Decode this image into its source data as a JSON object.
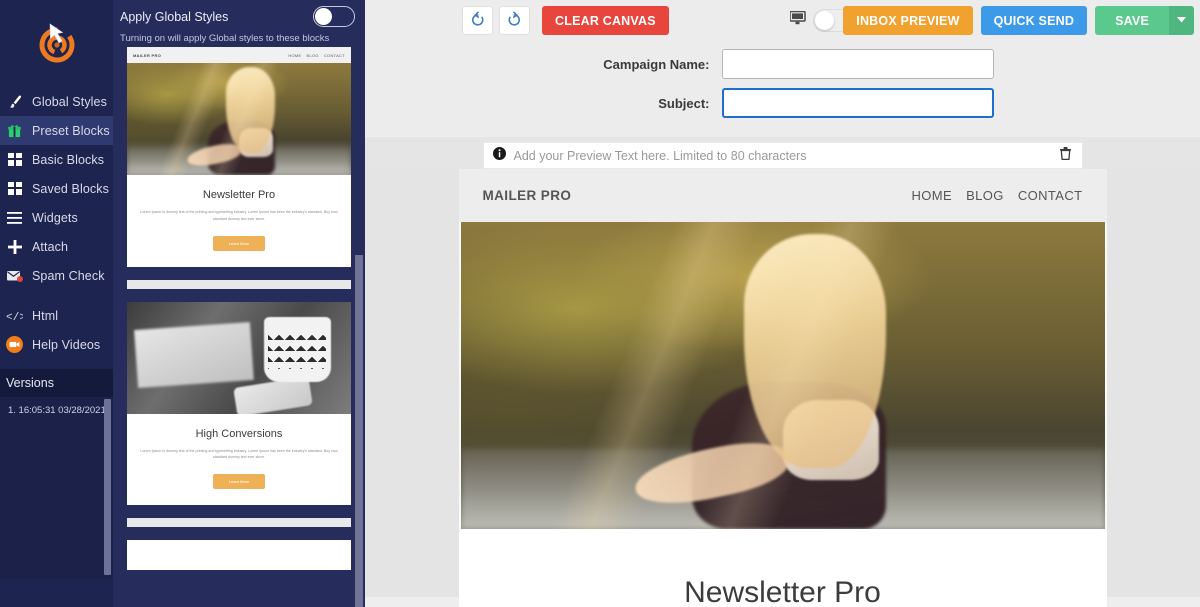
{
  "app": {
    "logo_icon": "target-cursor-logo"
  },
  "sidebar": {
    "items": [
      {
        "label": "Global Styles",
        "icon": "paintbrush-icon",
        "active": false
      },
      {
        "label": "Preset Blocks",
        "icon": "gift-icon",
        "active": true
      },
      {
        "label": "Basic Blocks",
        "icon": "grid-blocks-icon",
        "active": false
      },
      {
        "label": "Saved Blocks",
        "icon": "grid-blocks-icon",
        "active": false
      },
      {
        "label": "Widgets",
        "icon": "hamburger-icon",
        "active": false
      },
      {
        "label": "Attach",
        "icon": "plus-icon",
        "active": false
      },
      {
        "label": "Spam Check",
        "icon": "envelope-alert-icon",
        "active": false
      },
      {
        "label": "Html",
        "icon": "code-brackets-icon",
        "active": false
      },
      {
        "label": "Help Videos",
        "icon": "video-camera-icon",
        "active": false
      }
    ],
    "versions_header": "Versions",
    "versions": [
      "1. 16:05:31 03/28/2021"
    ]
  },
  "preset_panel": {
    "apply_global_styles_label": "Apply Global Styles",
    "apply_global_styles_on": false,
    "hint": "Turning on will apply Global styles to these blocks",
    "blocks": [
      {
        "brand": "MAILER PRO",
        "links": [
          "HOME",
          "BLOG",
          "CONTACT"
        ],
        "image": "sunset-woman-photo",
        "heading": "Newsletter Pro",
        "body": "Lorem Ipsum is dummy text of the printing and typesetting industry. Lorem Ipsum has been the industry's standard. Buy now standard dummy text ever since.",
        "button": "Learn More"
      },
      {
        "image": "desk-coffee-photo",
        "heading": "High Conversions",
        "body": "Lorem Ipsum is dummy text of the printing and typesetting industry. Lorem Ipsum has been the industry's standard. Buy now standard dummy text ever since.",
        "button": "Learn More"
      }
    ]
  },
  "toolbar": {
    "undo_icon": "undo-icon",
    "redo_icon": "redo-icon",
    "clear_canvas_label": "CLEAR CANVAS",
    "desktop_icon": "desktop-monitor-icon",
    "mobile_icon": "mobile-phone-icon",
    "device_mode": "desktop",
    "inbox_preview_label": "INBOX PREVIEW",
    "quick_send_label": "QUICK SEND",
    "save_label": "SAVE",
    "save_caret_icon": "chevron-down-icon",
    "colors": {
      "clear": "#e8453c",
      "inbox": "#f0a12e",
      "quick": "#3d9ae8",
      "save": "#5bc98d"
    }
  },
  "form": {
    "campaign_name_label": "Campaign Name:",
    "campaign_name_value": "",
    "subject_label": "Subject:",
    "subject_value": "",
    "subject_focused": true,
    "preview_text_placeholder": "Add your Preview Text here. Limited to 80 characters",
    "preview_info_icon": "info-icon",
    "preview_delete_icon": "trash-icon"
  },
  "email_canvas": {
    "brand": "MAILER PRO",
    "nav_links": [
      "HOME",
      "BLOG",
      "CONTACT"
    ],
    "hero_image": "sunset-woman-photo",
    "heading": "Newsletter Pro"
  }
}
